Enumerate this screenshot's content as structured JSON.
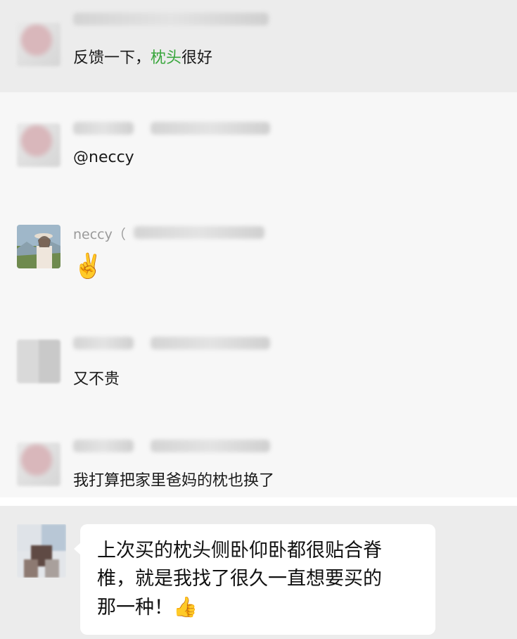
{
  "messages": [
    {
      "text_before": "反馈一下，",
      "text_highlight": "枕头",
      "text_after": "很好"
    },
    {
      "text": "@neccy"
    },
    {
      "sender": "neccy（",
      "emoji": "✌️"
    },
    {
      "text": "又不贵"
    },
    {
      "text": "我打算把家里爸妈的枕也换了"
    }
  ],
  "bottom_bubble": {
    "line1": "上次买的枕头侧卧仰卧都很贴合脊",
    "line2": "椎，就是我找了很久一直想要买的",
    "line3": "那一种！",
    "emoji": "👍"
  },
  "colors": {
    "highlight": "#39a63d",
    "row_bg": "#f7f7f7",
    "row_hl_bg": "#ececec"
  }
}
